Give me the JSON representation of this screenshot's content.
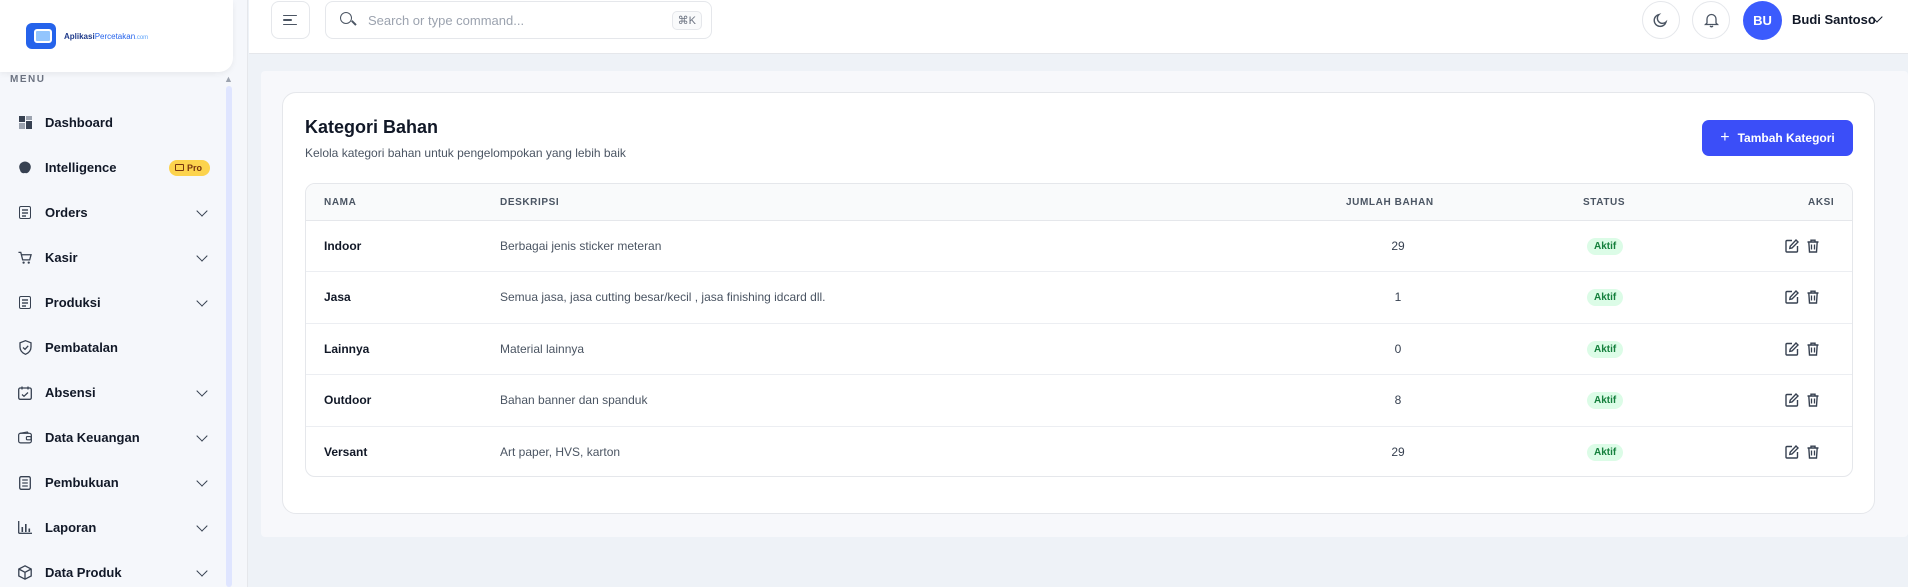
{
  "brand": {
    "name_a": "Aplikasi",
    "name_b": "Percetakan",
    "domain": ".com"
  },
  "sidebar": {
    "menu_label": "MENU",
    "items": [
      {
        "label": "Dashboard",
        "icon": "dashboard-icon",
        "chevron": false
      },
      {
        "label": "Intelligence",
        "icon": "brain-icon",
        "chevron": false,
        "badge": "Pro"
      },
      {
        "label": "Orders",
        "icon": "orders-icon",
        "chevron": true
      },
      {
        "label": "Kasir",
        "icon": "cart-icon",
        "chevron": true
      },
      {
        "label": "Produksi",
        "icon": "production-icon",
        "chevron": true
      },
      {
        "label": "Pembatalan",
        "icon": "shield-icon",
        "chevron": false
      },
      {
        "label": "Absensi",
        "icon": "calendar-check-icon",
        "chevron": true
      },
      {
        "label": "Data Keuangan",
        "icon": "wallet-icon",
        "chevron": true
      },
      {
        "label": "Pembukuan",
        "icon": "ledger-icon",
        "chevron": true
      },
      {
        "label": "Laporan",
        "icon": "bar-chart-icon",
        "chevron": true
      },
      {
        "label": "Data Produk",
        "icon": "box-icon",
        "chevron": true
      }
    ]
  },
  "topbar": {
    "search_placeholder": "Search or type command...",
    "shortcut": "⌘K",
    "user_initials": "BU",
    "user_name": "Budi Santoso"
  },
  "page": {
    "title": "Kategori Bahan",
    "subtitle": "Kelola kategori bahan untuk pengelompokan yang lebih baik",
    "add_button": "Tambah Kategori"
  },
  "table": {
    "headers": {
      "name": "NAMA",
      "desc": "DESKRIPSI",
      "count": "JUMLAH BAHAN",
      "status": "STATUS",
      "actions": "AKSI"
    },
    "rows": [
      {
        "name": "Indoor",
        "desc": "Berbagai jenis sticker meteran",
        "count": "29",
        "status": "Aktif"
      },
      {
        "name": "Jasa",
        "desc": "Semua jasa, jasa cutting besar/kecil , jasa finishing idcard dll.",
        "count": "1",
        "status": "Aktif"
      },
      {
        "name": "Lainnya",
        "desc": "Material lainnya",
        "count": "0",
        "status": "Aktif"
      },
      {
        "name": "Outdoor",
        "desc": "Bahan banner dan spanduk",
        "count": "8",
        "status": "Aktif"
      },
      {
        "name": "Versant",
        "desc": "Art paper, HVS, karton",
        "count": "29",
        "status": "Aktif"
      }
    ]
  },
  "colors": {
    "primary": "#3b4ef8",
    "status_bg": "#dcfce7",
    "status_text": "#15803d",
    "pro_badge": "#fcd34d"
  }
}
